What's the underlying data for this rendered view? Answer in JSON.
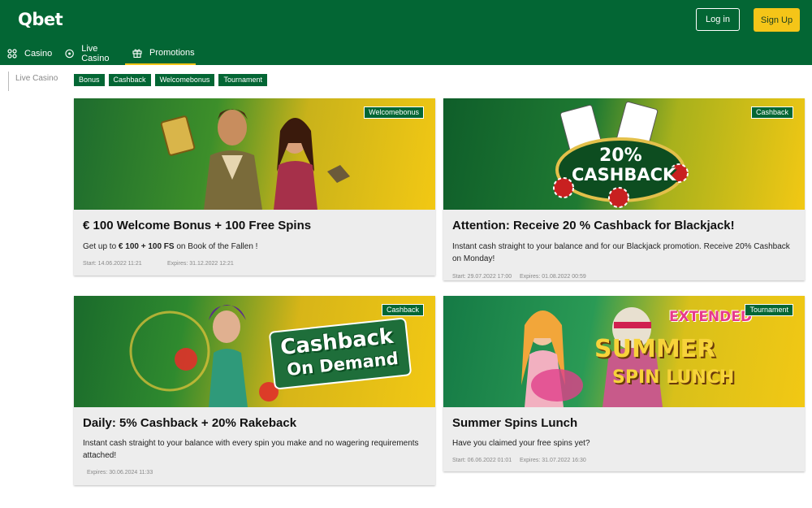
{
  "header": {
    "logo": "Qbet",
    "login_label": "Log in",
    "signup_label": "Sign Up"
  },
  "nav": [
    {
      "label": "Casino",
      "icon": "casino-icon"
    },
    {
      "label": "Live Casino",
      "icon": "live-casino-icon"
    },
    {
      "label": "Promotions",
      "icon": "gift-icon"
    }
  ],
  "sidebar": {
    "label": "Live Casino"
  },
  "tags": [
    "Bonus",
    "Cashback",
    "Welcomebonus",
    "Tournament"
  ],
  "cards": [
    {
      "tag": "Welcomebonus",
      "title": "€ 100 Welcome Bonus + 100 Free Spins",
      "desc_prefix": "Get up to ",
      "desc_bold": "€ 100 + 100 FS",
      "desc_suffix": " on Book of the Fallen !",
      "start": "Start: 14.06.2022 11:21",
      "expires": "Expires: 31.12.2022 12:21"
    },
    {
      "tag": "Cashback",
      "title": "Attention: Receive 20 % Cashback for Blackjack!",
      "desc": "Instant cash straight to your balance and for our Blackjack promotion. Receive 20% Cashback on Monday!",
      "start": "Start: 29.07.2022 17:00",
      "expires": "Expires: 01.08.2022 00:59",
      "img_line1": "20%",
      "img_line2": "CASHBACK"
    },
    {
      "tag": "Cashback",
      "title": "Daily: 5% Cashback + 20% Rakeback",
      "desc": "Instant cash straight to your balance with every spin you make and no wagering requirements attached!",
      "expires": "Expires: 30.06.2024 11:33",
      "img_line1": "Cashback",
      "img_line2": "On Demand"
    },
    {
      "tag": "Tournament",
      "title": "Summer Spins Lunch",
      "desc": "Have you claimed your free spins yet?",
      "start": "Start: 06.06.2022 01:01",
      "expires": "Expires: 31.07.2022 16:30",
      "img_line0": "EXTENDED",
      "img_line1": "SUMMER",
      "img_line2": "SPIN LUNCH"
    }
  ],
  "colors": {
    "brand_green": "#036634",
    "accent_yellow": "#f5c518",
    "card_bg": "#ededed"
  }
}
